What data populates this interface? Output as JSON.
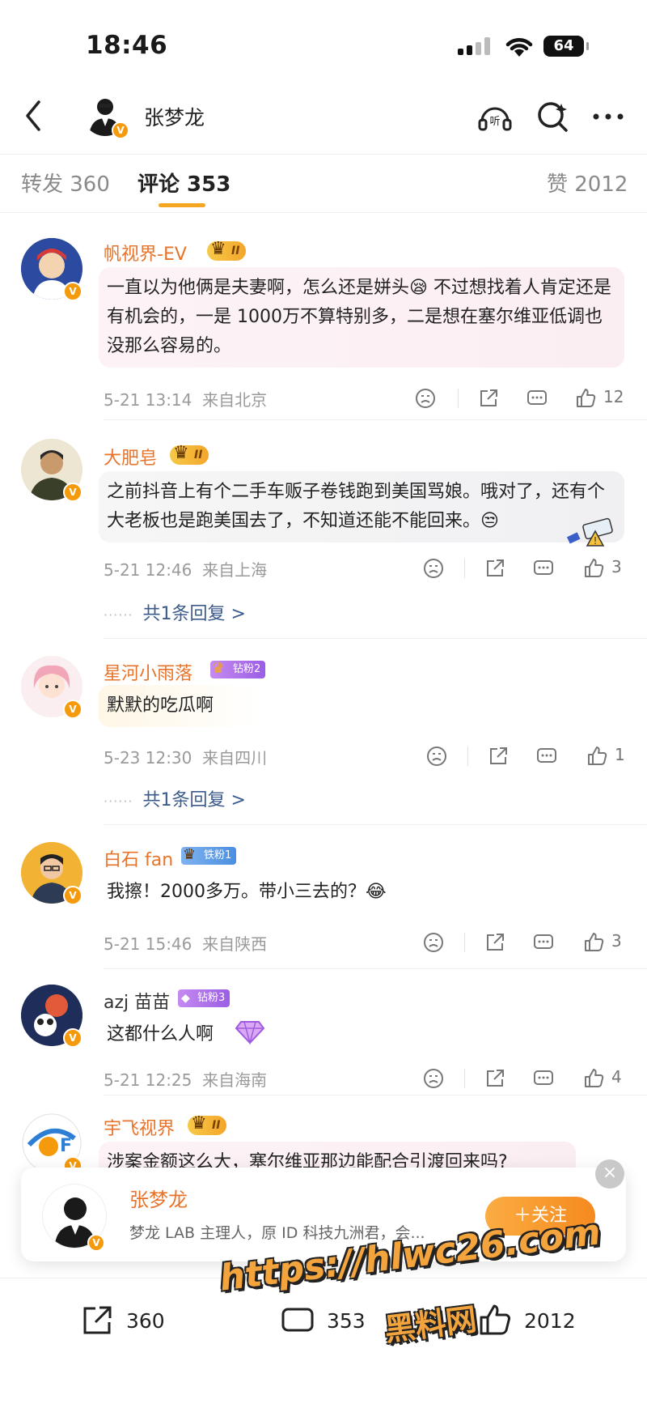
{
  "status_bar": {
    "time": "18:46",
    "battery": "64"
  },
  "header": {
    "title": "张梦龙"
  },
  "tabs": [
    {
      "label": "转发 360"
    },
    {
      "label": "评论 353"
    },
    {
      "label": "赞 2012"
    }
  ],
  "comments": [
    {
      "name": "帆视界-EV",
      "badge": "II",
      "text": "一直以为他俩是夫妻啊，怎么还是姘头😪 不过想找着人肯定还是有机会的，一是 1000万不算特别多，二是想在塞尔维亚低调也没那么容易的。",
      "time": "5-21 13:14",
      "location": "来自北京",
      "likes": "12"
    },
    {
      "name": "大肥皂",
      "badge": "II",
      "text": "之前抖音上有个二手车贩子卷钱跑到美国骂娘。哦对了，还有个大老板也是跑美国去了，不知道还能不能回来。😒",
      "time": "5-21 12:46",
      "location": "来自上海",
      "likes": "3",
      "replies": "共1条回复 >"
    },
    {
      "name": "星河小雨落",
      "badge": "钻粉2",
      "text": "默默的吃瓜啊",
      "time": "5-23 12:30",
      "location": "来自四川",
      "likes": "1",
      "replies": "共1条回复 >"
    },
    {
      "name": "白石 fan",
      "badge": "铁粉1",
      "text": "我擦！2000多万。带小三去的？😂",
      "time": "5-21 15:46",
      "location": "来自陕西",
      "likes": "3"
    },
    {
      "name": "azj 苗苗",
      "badge": "钻粉3",
      "text": "这都什么人啊",
      "time": "5-21 12:25",
      "location": "来自海南",
      "likes": "4"
    },
    {
      "name": "宇飞视界",
      "badge": "II",
      "text": "涉案金额这么大，塞尔维亚那边能配合引渡回来吗?"
    }
  ],
  "popup": {
    "name": "张梦龙",
    "desc": "梦龙 LAB 主理人，原 ID 科技九洲君，会...",
    "follow": "＋关注",
    "close": "×"
  },
  "bottom_bar": {
    "repost": "360",
    "comment": "353",
    "like": "2012"
  },
  "watermark": {
    "url": "https://hlwc26.com",
    "site": "黑料网"
  },
  "colors": {
    "accent": "#f5a623",
    "name": "#e8732a",
    "link": "#3b5b8c"
  }
}
